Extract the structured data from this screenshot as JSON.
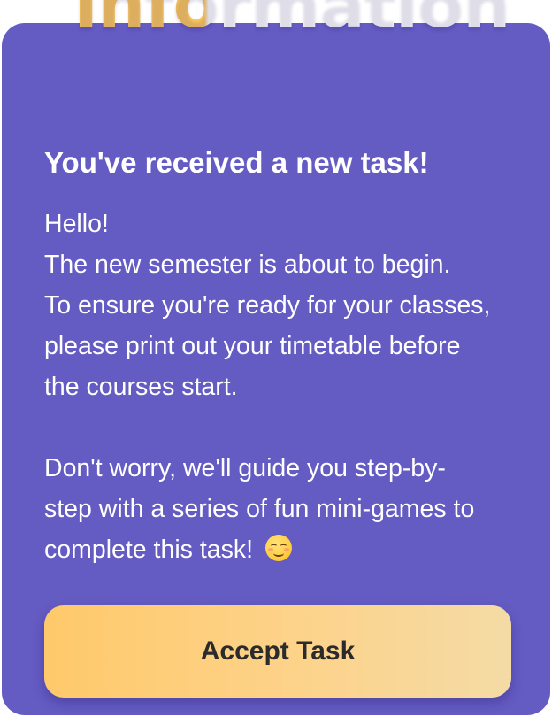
{
  "banner": {
    "title": "Information"
  },
  "task": {
    "heading": "You've received a new task!",
    "lines": [
      "Hello!",
      "The new semester is about to begin.",
      "To ensure you're ready for your classes,",
      "please print out your timetable before",
      "the courses start."
    ],
    "followup_lines": [
      "Don't worry, we'll guide you step-by-",
      "step with a series of fun mini-games to",
      "complete this task!"
    ],
    "emoji_icon": "smiling-face-icon"
  },
  "button": {
    "label": "Accept Task"
  },
  "colors": {
    "card_bg": "#645bc3",
    "title_gold": "#fcc85e",
    "button_gradient_start": "#fec96a",
    "button_gradient_end": "#f4dba5",
    "text": "#ffffff",
    "button_text": "#2b2b2b"
  }
}
